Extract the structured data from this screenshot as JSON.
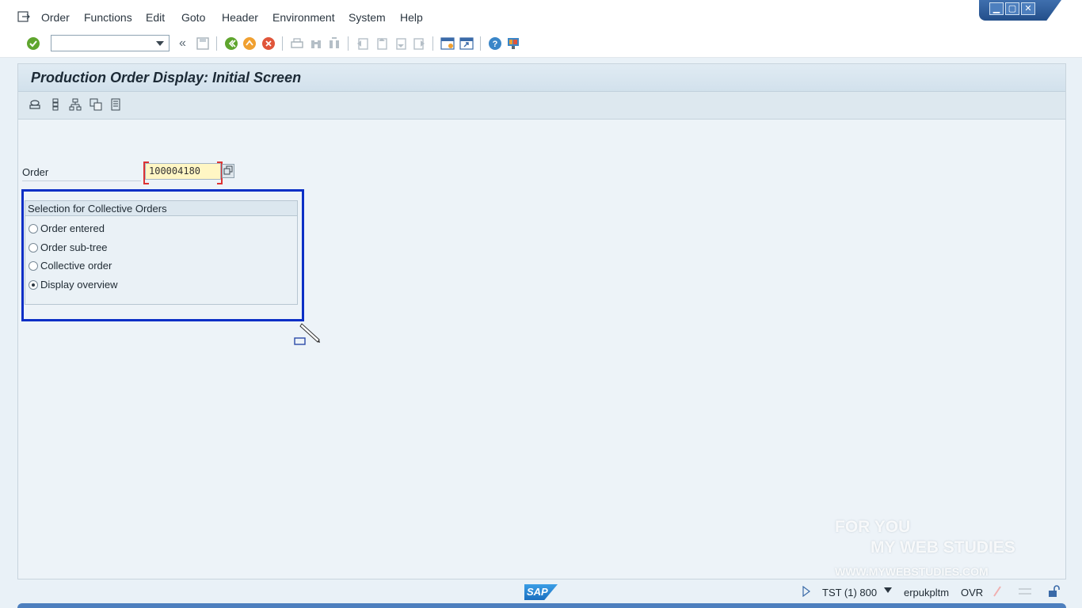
{
  "menubar": {
    "items": [
      "Order",
      "Functions",
      "Edit",
      "Goto",
      "Header",
      "Environment",
      "System",
      "Help"
    ]
  },
  "window_controls": {
    "minimize": "▁",
    "maximize": "▢",
    "close": "✕"
  },
  "toolbar": {
    "command_field": {
      "value": "",
      "placeholder": ""
    },
    "back_chevron": "«"
  },
  "screen": {
    "title": "Production Order Display: Initial Screen"
  },
  "form": {
    "order_label": "Order",
    "order_value": "100004180"
  },
  "selection_group": {
    "title": "Selection for Collective Orders",
    "options": [
      {
        "label": "Order entered",
        "selected": false
      },
      {
        "label": "Order sub-tree",
        "selected": false
      },
      {
        "label": "Collective order",
        "selected": false
      },
      {
        "label": "Display overview",
        "selected": true
      }
    ]
  },
  "statusbar": {
    "logo": "SAP",
    "system": "TST (1) 800",
    "server": "erpukpltm",
    "mode": "OVR"
  },
  "watermark": {
    "line1": "FOR YOU",
    "line2": "MY WEB STUDIES",
    "line3": "WWW.MYWEBSTUDIES.COM"
  },
  "colors": {
    "highlight_box": "#0b2fc6",
    "required_field_bg": "#fff6c4",
    "background": "#e9f1f7"
  }
}
